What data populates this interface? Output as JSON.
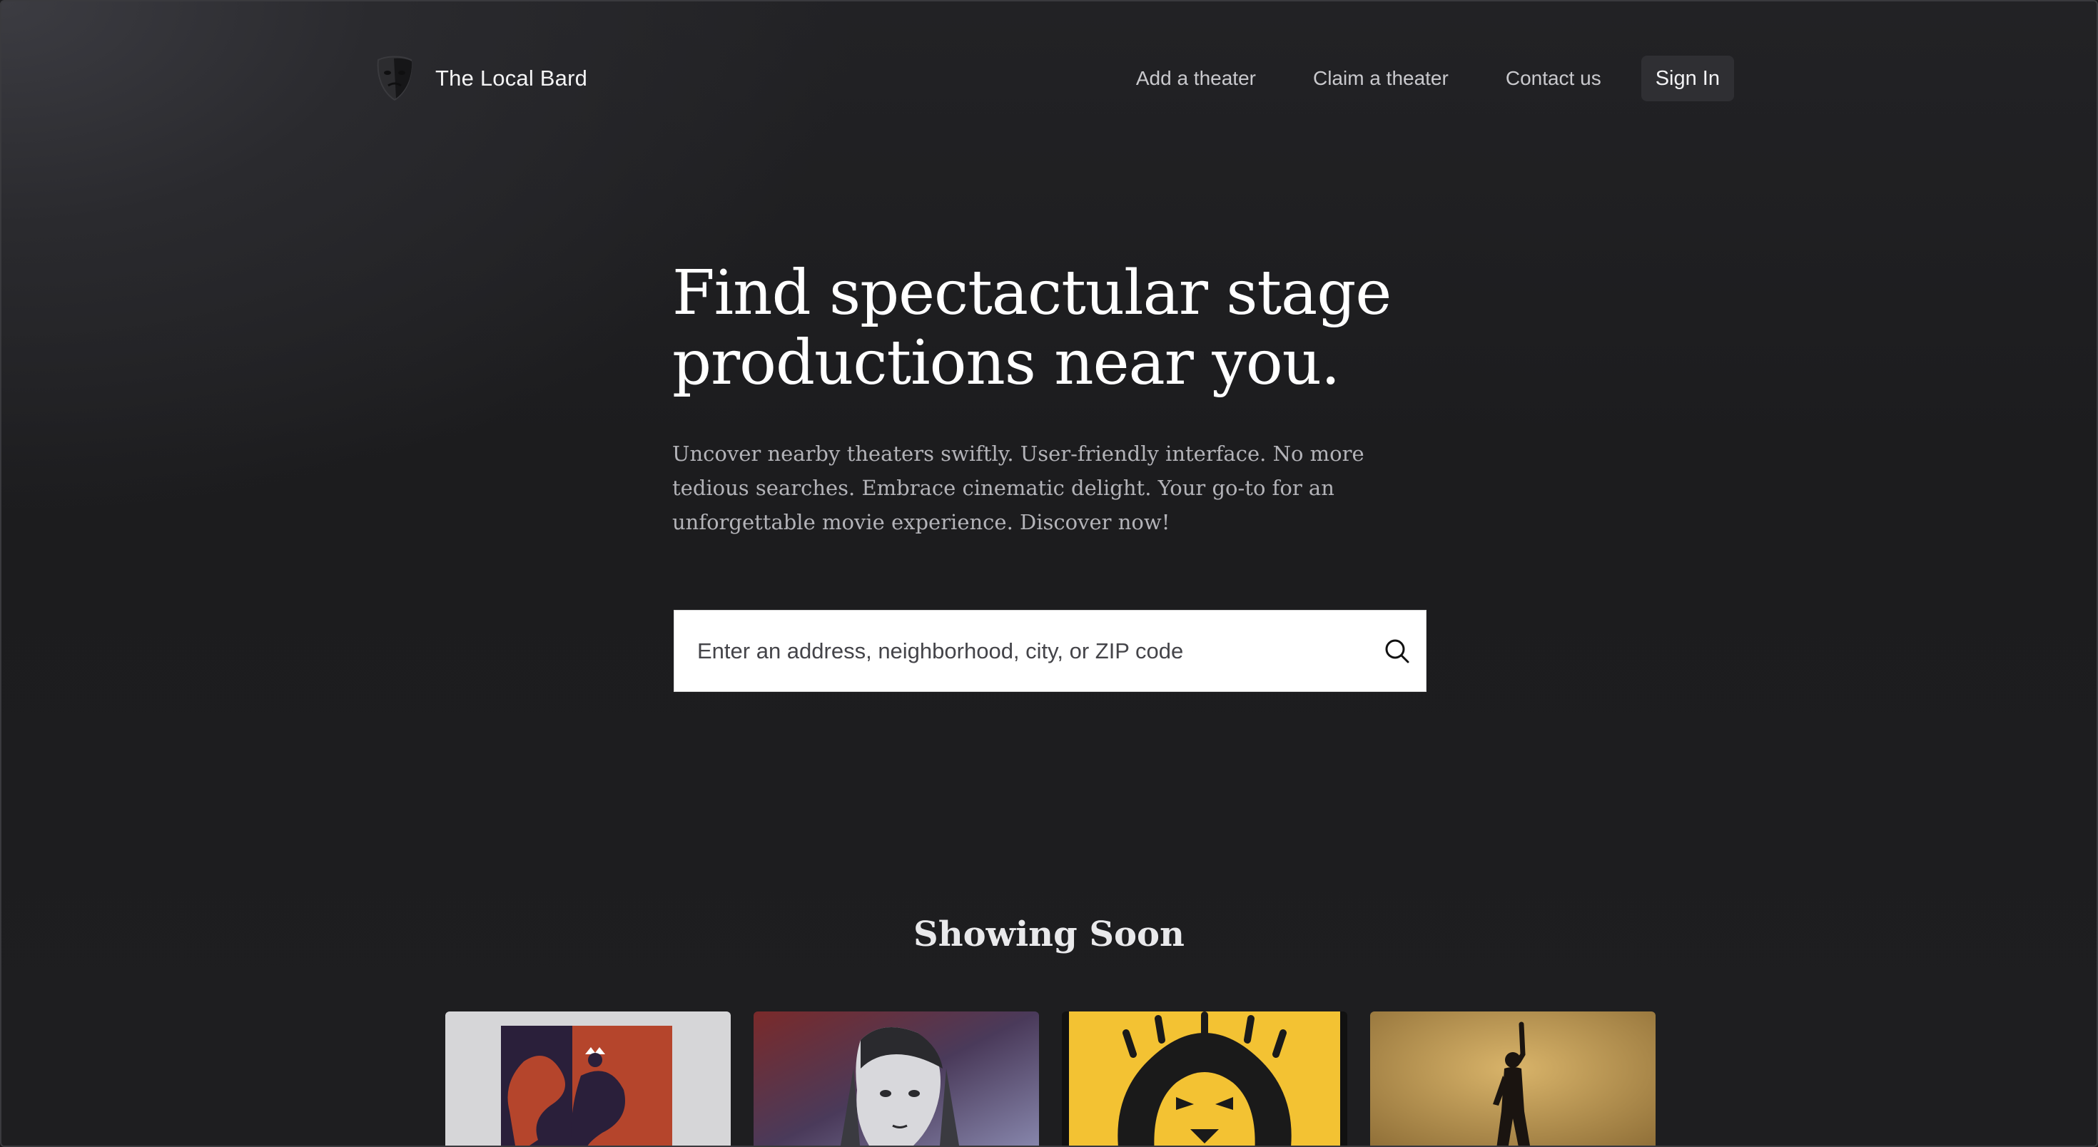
{
  "header": {
    "brand_name": "The Local Bard",
    "brand_logo": "theater-mask-icon",
    "nav": [
      {
        "label": "Add a theater"
      },
      {
        "label": "Claim a theater"
      },
      {
        "label": "Contact us"
      }
    ],
    "sign_in_label": "Sign In"
  },
  "hero": {
    "title_line1": "Find spectactular stage",
    "title_line2": "productions near you.",
    "subtitle": "Uncover nearby theaters swiftly. User-friendly interface. No more tedious searches. Embrace cinematic delight. Your go-to for an unforgettable movie experience. Discover now!"
  },
  "search": {
    "placeholder": "Enter an address, neighborhood, city, or ZIP code",
    "value": "",
    "icon": "search-icon"
  },
  "showing_soon": {
    "title": "Showing Soon",
    "posters": [
      {
        "icon": "poster-red-figure",
        "accent": "#b5452c"
      },
      {
        "icon": "poster-les-miserables-girl",
        "accent": "#5a4a7a"
      },
      {
        "icon": "poster-lion-king",
        "accent": "#f3c233"
      },
      {
        "icon": "poster-hamilton-silhouette",
        "accent": "#c89a4a"
      }
    ]
  },
  "colors": {
    "background": "#1c1c1e",
    "signin_bg": "#2f2f33",
    "text_primary": "#ffffff",
    "text_muted": "#b3b3b8"
  }
}
